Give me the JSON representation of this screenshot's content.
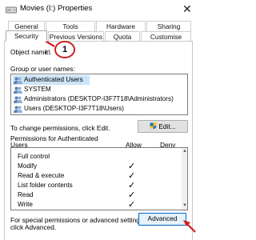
{
  "window": {
    "title": "Movies (I:) Properties",
    "close_glyph": "✕"
  },
  "tabs": {
    "row1": [
      "General",
      "Tools",
      "Hardware",
      "Sharing"
    ],
    "row2": [
      "Security",
      "Previous Versions",
      "Quota",
      "Customise"
    ],
    "selected": "Security"
  },
  "object": {
    "label": "Object name:",
    "value": "I:\\"
  },
  "groups": {
    "label": "Group or user names:",
    "items": [
      "Authenticated Users",
      "SYSTEM",
      "Administrators (DESKTOP-I3F7T18\\Administrators)",
      "Users (DESKTOP-I3F7T18\\Users)"
    ],
    "selected_index": 0
  },
  "change_text": "To change permissions, click Edit.",
  "edit_button": "Edit...",
  "permissions": {
    "header_line1": "Permissions for Authenticated",
    "header_line2": "Users",
    "allow_label": "Allow",
    "deny_label": "Deny",
    "rows": [
      {
        "name": "Full control",
        "allow": ""
      },
      {
        "name": "Modify",
        "allow": "✓"
      },
      {
        "name": "Read & execute",
        "allow": "✓"
      },
      {
        "name": "List folder contents",
        "allow": "✓"
      },
      {
        "name": "Read",
        "allow": "✓"
      },
      {
        "name": "Write",
        "allow": "✓"
      }
    ]
  },
  "special_text_line1": "For special permissions or advanced settings,",
  "special_text_line2": "click Advanced.",
  "advanced_button": "Advanced",
  "annotation": {
    "number": "1",
    "color": "#d01f1f"
  },
  "colors": {
    "selection": "#cce4f7",
    "accent": "#0067c0",
    "annotation": "#d01f1f"
  }
}
